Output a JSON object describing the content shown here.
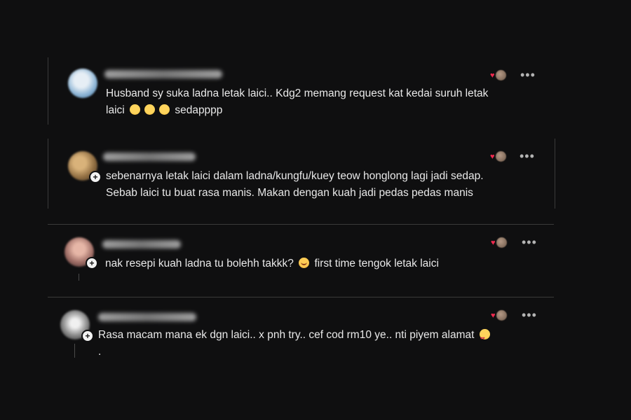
{
  "comments": [
    {
      "id": 1,
      "avatar_color": "#8fb6d6",
      "lines": [
        "Husband sy suka ladna letak laici.. Kdg2 memang request kat kedai suruh letak",
        "laici"
      ],
      "emoji_suffix": "sedapppp",
      "emojis": [
        "hand-over-mouth-emoji",
        "hand-over-mouth-emoji",
        "hand-over-mouth-emoji"
      ]
    },
    {
      "id": 2,
      "avatar_color": "#b58f5c",
      "lines": [
        "sebenarnya letak laici dalam ladna/kungfu/kuey teow honglong lagi jadi sedap.",
        "Sebab laici tu buat rasa manis. Makan dengan kuah jadi pedas pedas manis"
      ]
    },
    {
      "id": 3,
      "avatar_color": "#c08a86",
      "text_before": "nak resepi kuah ladna tu bolehh takkk?",
      "text_after": "first time tengok letak laici",
      "emojis": [
        "crying-face-emoji"
      ]
    },
    {
      "id": 4,
      "avatar_color": "#d8d8d8",
      "text": "Rasa macam mana ek dgn laici.. x pnh try.. cef cod rm10 ye.. nti piyem alamat",
      "second_line": ".",
      "emojis": [
        "smiling-heart-eyes-emoji"
      ]
    }
  ],
  "more_label": "•••",
  "colors": {
    "background": "#0f0f10",
    "text": "#e9e9e9",
    "heart": "#ef2a4e",
    "divider": "#3a3a3a"
  }
}
